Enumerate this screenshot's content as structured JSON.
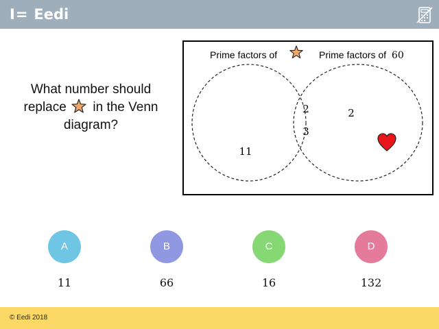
{
  "header": {
    "brand": "Eedi",
    "logo_mark": "I="
  },
  "question": {
    "text_before": "What number should replace",
    "text_after": "in the Venn diagram?",
    "star_icon": "star-icon"
  },
  "venn": {
    "left_label": "Prime factors of",
    "right_label_prefix": "Prime factors of",
    "right_label_number": "60",
    "left_only": [
      "11"
    ],
    "intersection": [
      "2",
      "3"
    ],
    "right_only": [
      "2"
    ],
    "right_icon": "heart-icon",
    "colors": {
      "star_fill": "#f0a86a",
      "heart_fill": "#e8171c"
    }
  },
  "options": [
    {
      "letter": "A",
      "value": "11",
      "color": "#6ec6e4"
    },
    {
      "letter": "B",
      "value": "66",
      "color": "#8f98e0"
    },
    {
      "letter": "C",
      "value": "16",
      "color": "#85d874"
    },
    {
      "letter": "D",
      "value": "132",
      "color": "#e47a9c"
    }
  ],
  "footer": {
    "copyright": "© Eedi 2018"
  }
}
